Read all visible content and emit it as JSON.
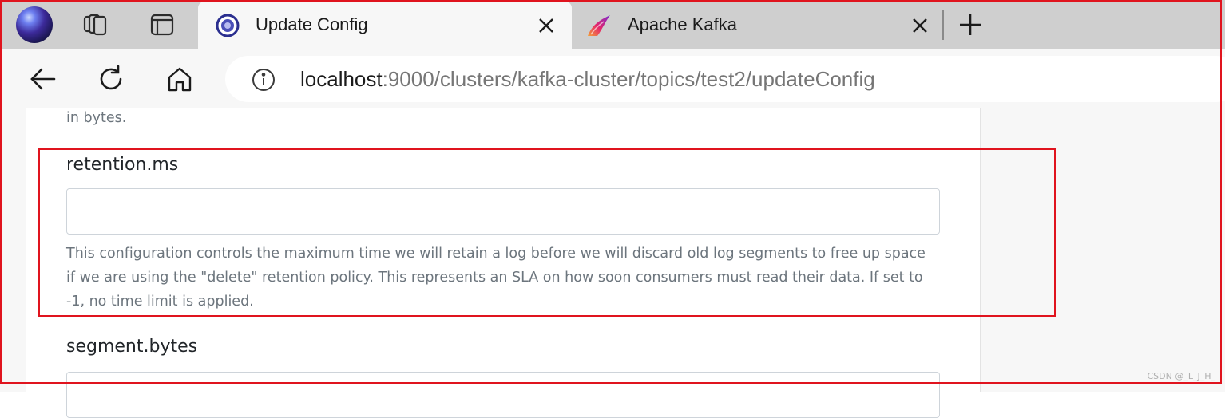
{
  "browser": {
    "tabs": [
      {
        "title": "Update Config",
        "active": true,
        "favicon": "globe-dots-icon"
      },
      {
        "title": "Apache Kafka",
        "active": false,
        "favicon": "kafka-logo-icon"
      }
    ],
    "address_bar": {
      "host": "localhost",
      "path": ":9000/clusters/kafka-cluster/topics/test2/updateConfig"
    }
  },
  "page": {
    "previous_field_help_tail": "in bytes.",
    "fields": [
      {
        "name": "retention.ms",
        "value": "",
        "help_lines": [
          "This configuration controls the maximum time we will retain a log before we will discard old log segments to free up space",
          "if we are using the \"delete\" retention policy. This represents an SLA on how soon consumers must read their data. If set to",
          "-1, no time limit is applied."
        ]
      },
      {
        "name": "segment.bytes",
        "value": ""
      }
    ]
  },
  "watermark": "CSDN @_L_J_H_",
  "colors": {
    "highlight": "#e0141e",
    "help_text": "#6c757d",
    "tab_strip": "#cfcfcf"
  }
}
